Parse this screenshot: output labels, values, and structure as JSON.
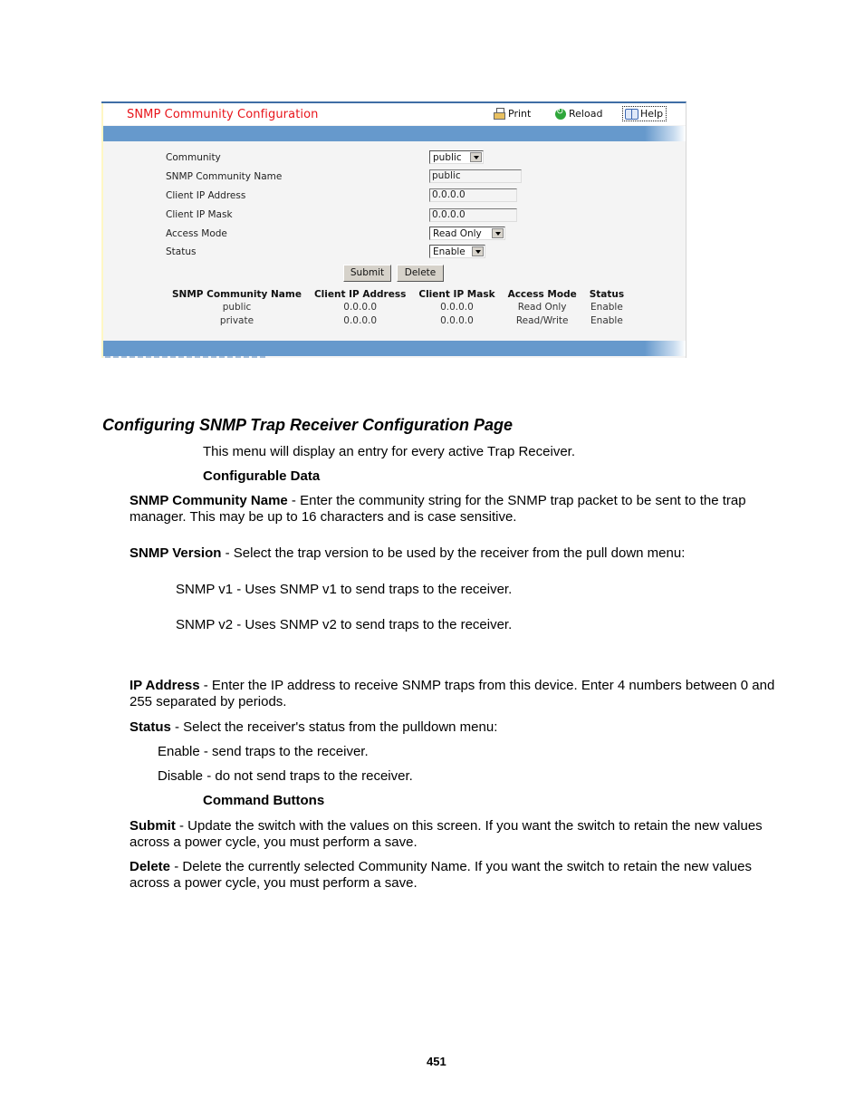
{
  "screenshot": {
    "title": "SNMP Community Configuration",
    "toolbar": {
      "print_label": "Print",
      "reload_label": "Reload",
      "help_label": "Help"
    },
    "form": {
      "community": {
        "label": "Community",
        "value": "public"
      },
      "community_name": {
        "label": "SNMP Community Name",
        "value": "public"
      },
      "client_ip_address": {
        "label": "Client IP Address",
        "value": "0.0.0.0"
      },
      "client_ip_mask": {
        "label": "Client IP Mask",
        "value": "0.0.0.0"
      },
      "access_mode": {
        "label": "Access Mode",
        "value": "Read Only"
      },
      "status": {
        "label": "Status",
        "value": "Enable"
      }
    },
    "buttons": {
      "submit": "Submit",
      "delete": "Delete"
    },
    "table": {
      "headers": [
        "SNMP Community Name",
        "Client IP Address",
        "Client IP Mask",
        "Access Mode",
        "Status"
      ],
      "rows": [
        [
          "public",
          "0.0.0.0",
          "0.0.0.0",
          "Read Only",
          "Enable"
        ],
        [
          "private",
          "0.0.0.0",
          "0.0.0.0",
          "Read/Write",
          "Enable"
        ]
      ]
    },
    "colors": {
      "title_red": "#e8141a",
      "bar_blue": "#6699cc",
      "frame_blue": "#3f6ea5"
    }
  },
  "document": {
    "heading": "Configuring SNMP Trap Receiver Configuration Page",
    "intro": "This menu will display an entry for every active Trap Receiver.",
    "configurable_data_heading": "Configurable Data",
    "community_name": {
      "term": "SNMP Community Name",
      "text": " - Enter the community string for the SNMP trap packet to be sent to the trap manager. This may be up to 16 characters and is case sensitive."
    },
    "snmp_version": {
      "term": "SNMP Version",
      "text": " - Select the trap version to be used by the receiver from the pull down menu:"
    },
    "v1": "SNMP v1 - Uses SNMP v1 to send traps to the receiver.",
    "v2": "SNMP v2 - Uses SNMP v2 to send traps to the receiver.",
    "ip_address": {
      "term": "IP Address",
      "text": " - Enter the IP address to receive SNMP traps from this device. Enter 4 numbers between 0 and 255 separated by periods."
    },
    "status": {
      "term": "Status",
      "text": " - Select the receiver's status from the pulldown menu:"
    },
    "enable": "Enable - send traps to the receiver.",
    "disable": "Disable - do not send traps to the receiver.",
    "command_buttons_heading": "Command Buttons",
    "submit": {
      "term": "Submit",
      "text": " - Update the switch with the values on this screen. If you want the switch to retain the new values across a power cycle, you must perform a save."
    },
    "delete": {
      "term": "Delete",
      "text": " - Delete the currently selected Community Name. If you want the switch to retain the new values across a power cycle, you must perform a save."
    },
    "page_number": "451"
  }
}
